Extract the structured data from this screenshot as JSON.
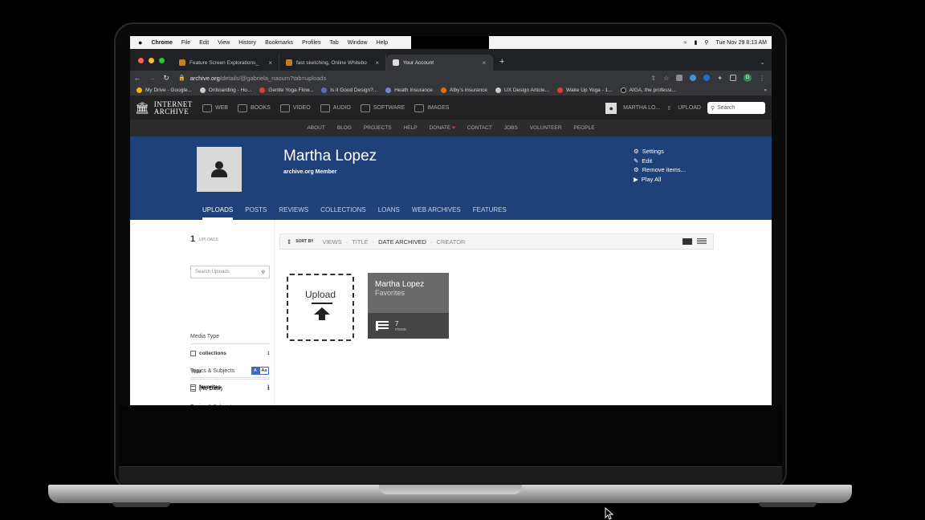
{
  "macos_menu": {
    "apple": "",
    "app": "Chrome",
    "items": [
      "File",
      "Edit",
      "View",
      "History",
      "Bookmarks",
      "Profiles",
      "Tab",
      "Window",
      "Help"
    ],
    "clock": "Tue Nov 29  8:13 AM"
  },
  "browser": {
    "tabs": [
      {
        "title": "Feature Screen Explorations_",
        "active": false
      },
      {
        "title": "fast sketching, Online Whitebo",
        "active": false
      },
      {
        "title": "Your Account",
        "active": true
      }
    ],
    "new_tab": "+",
    "url_host": "archive.org",
    "url_path": "/details/@gabriela_naoum?tab=uploads",
    "profile_initial": "G",
    "bookmarks": [
      "My Drive - Google...",
      "Onboarding - Ho...",
      "Gentle Yoga Flow...",
      "Is it Good Design?...",
      "Heath Insurance",
      "Alby's insurance",
      "UX Design Article...",
      "Wake Up Yoga - 1...",
      "AIGA, the professi..."
    ],
    "bookmarks_more": "»"
  },
  "ia_header": {
    "logo_line1": "INTERNET",
    "logo_line2": "ARCHIVE",
    "nav": [
      "WEB",
      "BOOKS",
      "VIDEO",
      "AUDIO",
      "SOFTWARE",
      "IMAGES"
    ],
    "user": "MARTHA LO...",
    "upload": "UPLOAD",
    "search_placeholder": "Search",
    "subnav": [
      "ABOUT",
      "BLOG",
      "PROJECTS",
      "HELP",
      "DONATE",
      "CONTACT",
      "JOBS",
      "VOLUNTEER",
      "PEOPLE"
    ]
  },
  "profile": {
    "name": "Martha Lopez",
    "role": "archive.org Member",
    "actions": [
      {
        "icon": "gear-icon",
        "label": "Settings"
      },
      {
        "icon": "pencil-icon",
        "label": "Edit"
      },
      {
        "icon": "gear-icon",
        "label": "Remove items..."
      },
      {
        "icon": "play-icon",
        "label": "Play All"
      }
    ],
    "tabs": [
      "UPLOADS",
      "POSTS",
      "REVIEWS",
      "COLLECTIONS",
      "LOANS",
      "WEB ARCHIVES",
      "FEATURES"
    ],
    "active_tab": "UPLOADS"
  },
  "sidebar": {
    "count": "1",
    "count_label": "UPLOADS",
    "search_placeholder": "Search Uploads",
    "facets": [
      {
        "heading": "Media Type",
        "rows": [
          {
            "label": "collections",
            "count": "1"
          }
        ]
      },
      {
        "heading": "Year",
        "rows": [
          {
            "label": "(No Date)",
            "count": "1"
          }
        ]
      },
      {
        "heading": "Topics & Subjects",
        "rows": [
          {
            "label": "favorites",
            "count": "1"
          }
        ]
      }
    ],
    "toggle": [
      "A",
      "Aa"
    ]
  },
  "sort": {
    "label": "SORT BY",
    "options": [
      "VIEWS",
      "TITLE",
      "DATE ARCHIVED",
      "CREATOR"
    ],
    "active": "DATE ARCHIVED"
  },
  "tiles": {
    "upload_label": "Upload",
    "collection": {
      "title": "Martha Lopez",
      "subtitle": "Favorites",
      "count": "7",
      "count_label": "ITEMS"
    }
  }
}
